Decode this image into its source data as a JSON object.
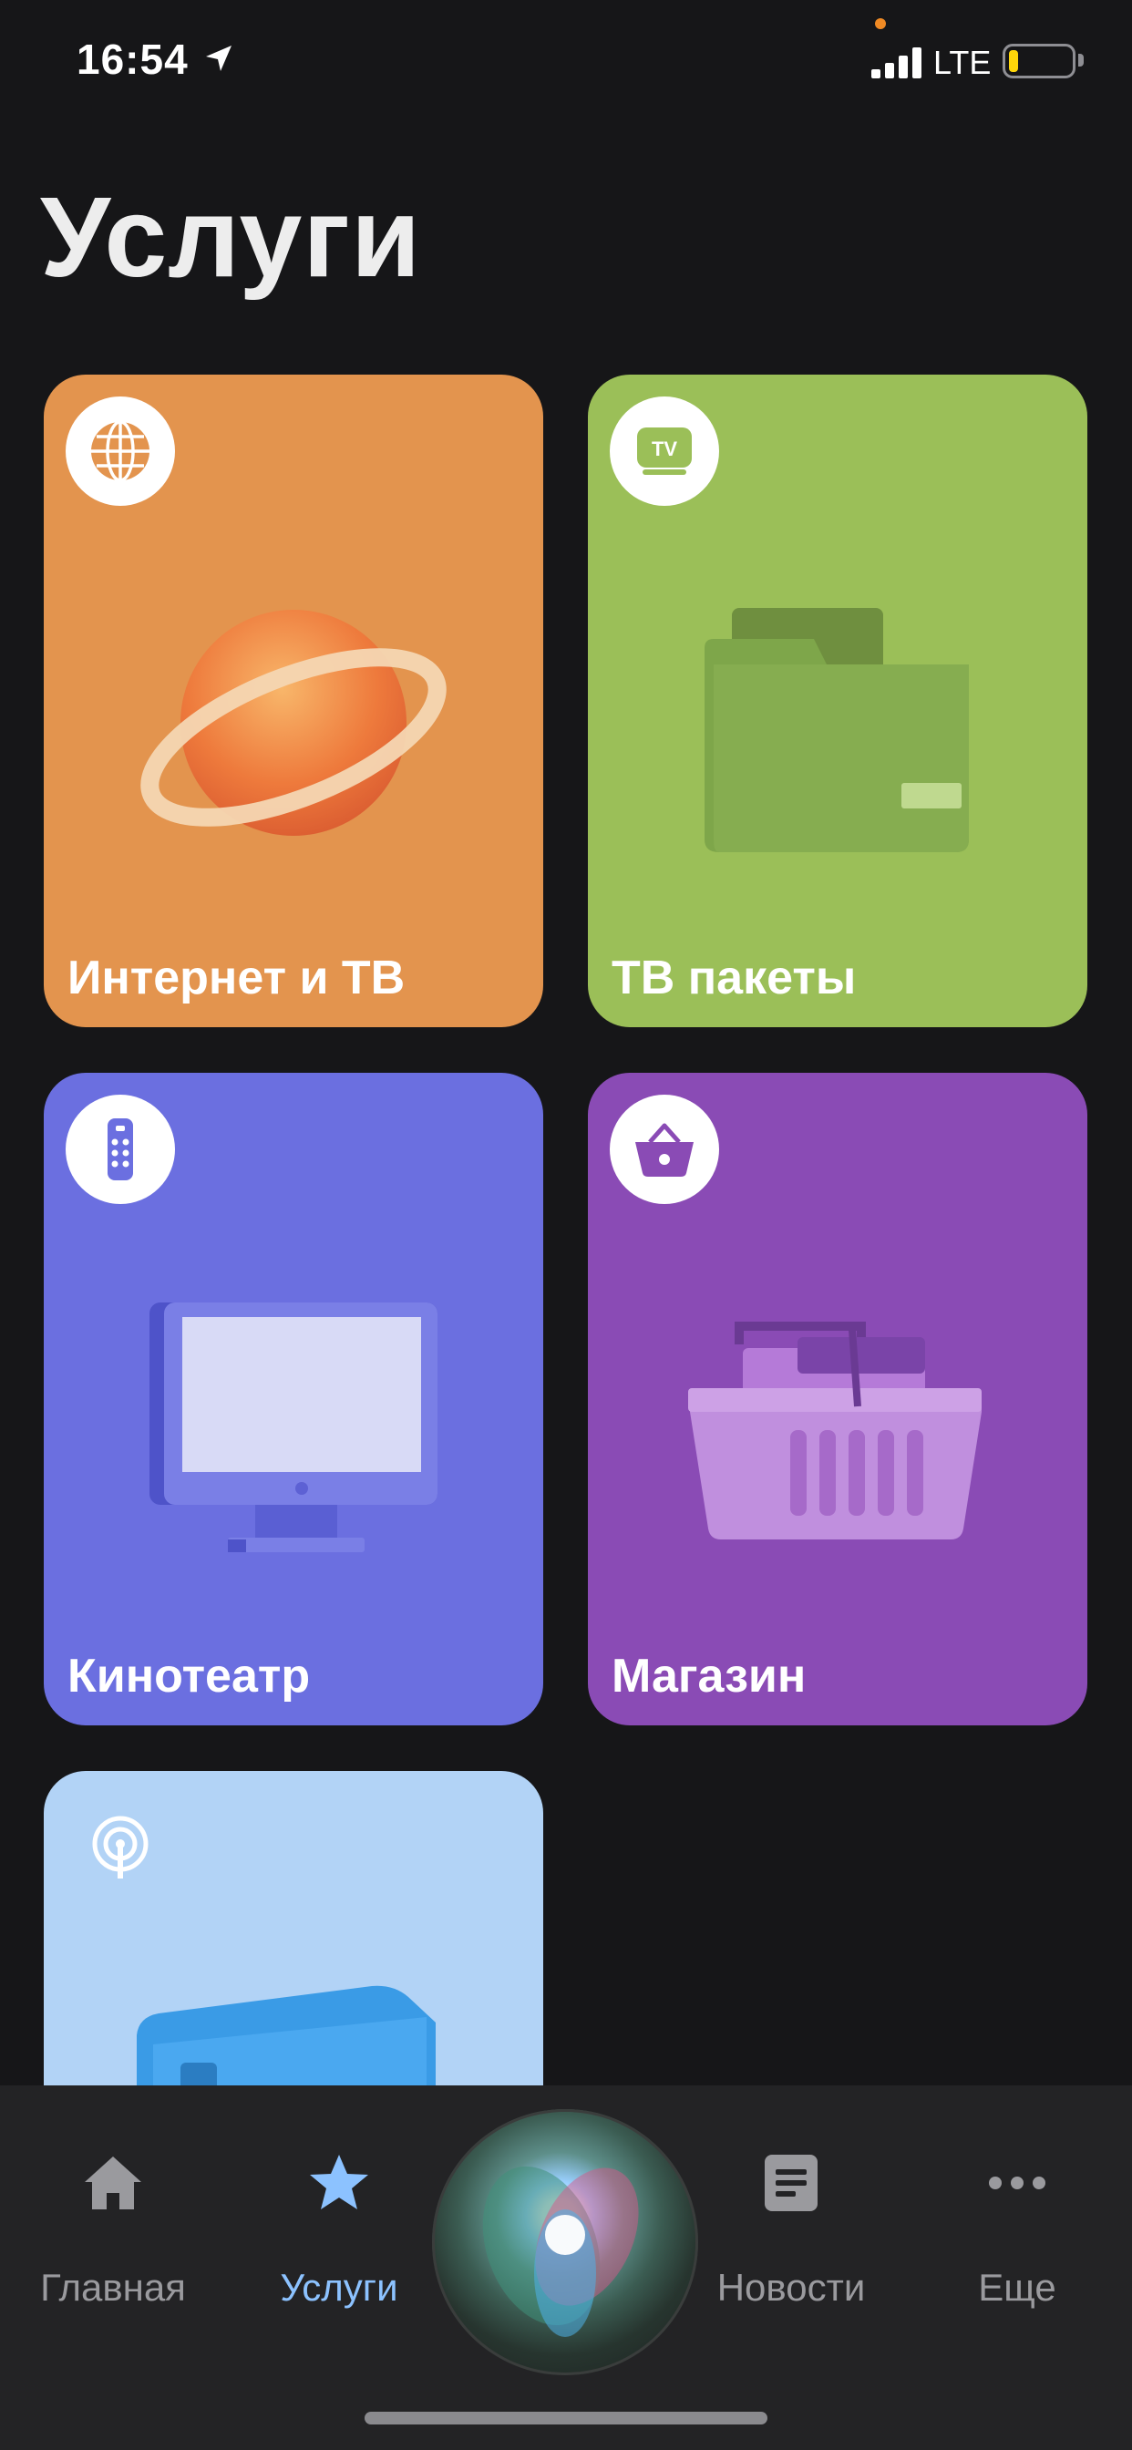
{
  "status_bar": {
    "time": "16:54",
    "network": "LTE",
    "battery_level": 0.15
  },
  "page": {
    "title": "Услуги"
  },
  "cards": [
    {
      "label": "Интернет и ТВ",
      "icon": "globe-icon",
      "color": "#e3944e"
    },
    {
      "label": "ТВ пакеты",
      "icon": "tv-icon",
      "icon_text": "TV",
      "color": "#9bbf58"
    },
    {
      "label": "Кинотеатр",
      "icon": "remote-icon",
      "color": "#6b6fe0"
    },
    {
      "label": "Магазин",
      "icon": "basket-icon",
      "color": "#8a4bb5"
    },
    {
      "label": "",
      "icon": "broadcast-icon",
      "color": "#b2d3f6"
    }
  ],
  "tab_bar": {
    "items": [
      {
        "label": "Главная",
        "icon": "home-icon",
        "active": false
      },
      {
        "label": "Услуги",
        "icon": "star-icon",
        "active": true
      },
      {
        "label": "Новости",
        "icon": "news-icon",
        "active": false
      },
      {
        "label": "Еще",
        "icon": "more-icon",
        "active": false
      }
    ],
    "center_button": "siri-orb"
  },
  "colors": {
    "background": "#161618",
    "tab_active": "#8cc2ff",
    "tab_inactive": "#9a9a9e"
  }
}
